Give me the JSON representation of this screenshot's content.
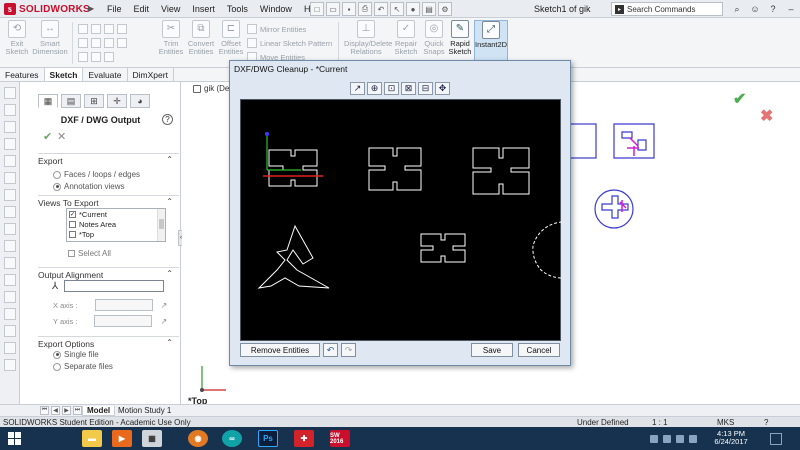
{
  "app": {
    "logo_text": "SOLIDWORKS",
    "document_title": "Sketch1 of gik",
    "search_placeholder": "Search Commands",
    "menu": [
      "File",
      "Edit",
      "View",
      "Insert",
      "Tools",
      "Window",
      "Help"
    ]
  },
  "ribbon": {
    "exit_sketch": "Exit Sketch",
    "smart_dimension": "Smart Dimension",
    "trim_entities": "Trim Entities",
    "convert_entities": "Convert Entities",
    "offset_entities": "Offset Entities",
    "mirror_entities": "Mirror Entities",
    "linear_sketch_pattern": "Linear Sketch Pattern",
    "move_entities": "Move Entities",
    "display_delete_relations": "Display/Delete Relations",
    "repair_sketch": "Repair Sketch",
    "quick_snaps": "Quick Snaps",
    "rapid_sketch": "Rapid Sketch",
    "instant2d": "Instant2D"
  },
  "command_tabs": [
    "Features",
    "Sketch",
    "Evaluate",
    "DimXpert"
  ],
  "property_manager": {
    "title": "DXF / DWG Output",
    "help": "?",
    "export": {
      "header": "Export",
      "options": [
        {
          "label": "Faces / loops / edges",
          "selected": false
        },
        {
          "label": "Annotation views",
          "selected": true
        }
      ]
    },
    "views_to_export": {
      "header": "Views To Export",
      "items": [
        {
          "label": "*Current",
          "checked": true
        },
        {
          "label": "Notes Area",
          "checked": false
        },
        {
          "label": "*Top",
          "checked": false
        }
      ],
      "select_all": "Select All"
    },
    "output_alignment": {
      "header": "Output Alignment",
      "x_axis_label": "X axis :",
      "y_axis_label": "Y axis :"
    },
    "export_options": {
      "header": "Export Options",
      "options": [
        {
          "label": "Single file",
          "selected": true
        },
        {
          "label": "Separate files",
          "selected": false
        }
      ]
    }
  },
  "graphics": {
    "tree_label": "gik (De",
    "view_label": "*Top"
  },
  "dialog": {
    "title": "DXF/DWG Cleanup - *Current",
    "remove_entities": "Remove Entities",
    "save": "Save",
    "cancel": "Cancel"
  },
  "model_tabs": [
    "Model",
    "Motion Study 1"
  ],
  "status": {
    "edition": "SOLIDWORKS Student Edition - Academic Use Only",
    "sketch_state": "Under Defined",
    "scale": "1 : 1",
    "units": "MKS",
    "question": "?"
  },
  "taskbar": {
    "time": "4:13 PM",
    "date": "6/24/2017",
    "apps": [
      "file-explorer",
      "media-player",
      "media-store",
      "firefox",
      "arduino",
      "photoshop",
      "solidworks-red",
      "solidworks-2016"
    ],
    "sw_badge": "SW 2016",
    "ps_label": "Ps",
    "arduino_label": "∞"
  }
}
